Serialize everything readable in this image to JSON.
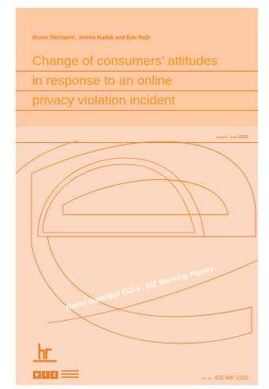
{
  "document": {
    "authors": "Bruno Škrinjarić, Jelena Budak and Edo Rajh",
    "title_lines": [
      "Change of consumers’ attitudes",
      "in response to an online",
      "privacy violation incident"
    ],
    "place_year_label": "Zagreb, lipanj",
    "year": "2022",
    "series_name": "Radni materijali EIZ-a . EIZ Working Papers",
    "logo_letters": [
      "e",
      "i",
      "z"
    ],
    "wp_number_prefix": "br. No",
    "wp_number": "EIZ-WP-2202"
  },
  "colors": {
    "accent": "#f47b20",
    "title": "#f7931e",
    "top_background": "#fcc9a2",
    "bottom_background": "#fbd8bf"
  },
  "icons": {
    "hrzz_logo": "hr-logo-icon",
    "eiz_logo": "eiz-logo"
  }
}
